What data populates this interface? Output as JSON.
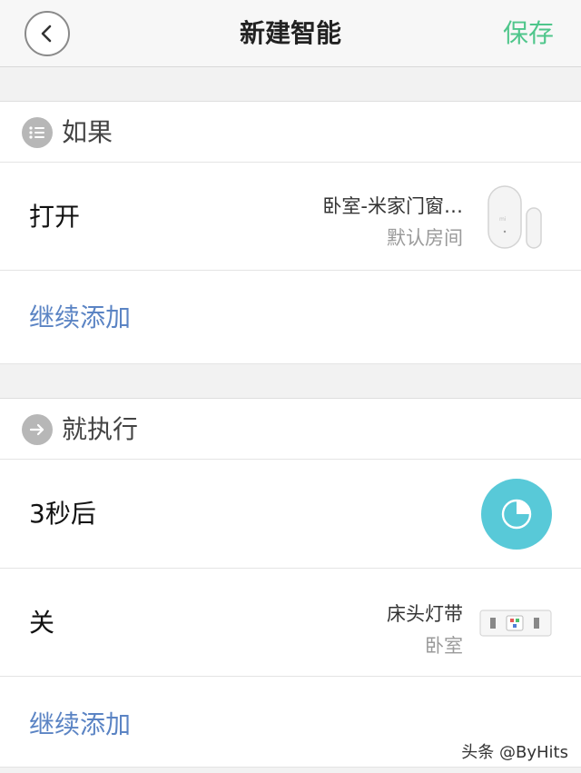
{
  "header": {
    "title": "新建智能",
    "save_label": "保存"
  },
  "if_section": {
    "title": "如果",
    "icon": "list-icon",
    "rows": [
      {
        "action": "打开",
        "device_name": "卧室-米家门窗…",
        "room": "默认房间",
        "device_icon": "door-window-sensor-icon"
      }
    ],
    "add_label": "继续添加"
  },
  "then_section": {
    "title": "就执行",
    "icon": "arrow-right-icon",
    "delay_row": {
      "label": "3秒后",
      "icon": "timer-icon",
      "icon_color": "#58c9d8"
    },
    "rows": [
      {
        "action": "关",
        "device_name": "床头灯带",
        "room": "卧室",
        "device_icon": "light-strip-icon"
      }
    ],
    "add_label": "继续添加"
  },
  "watermark": "头条 @ByHits",
  "colors": {
    "accent": "#4fc68b",
    "link": "#5b84c4"
  }
}
